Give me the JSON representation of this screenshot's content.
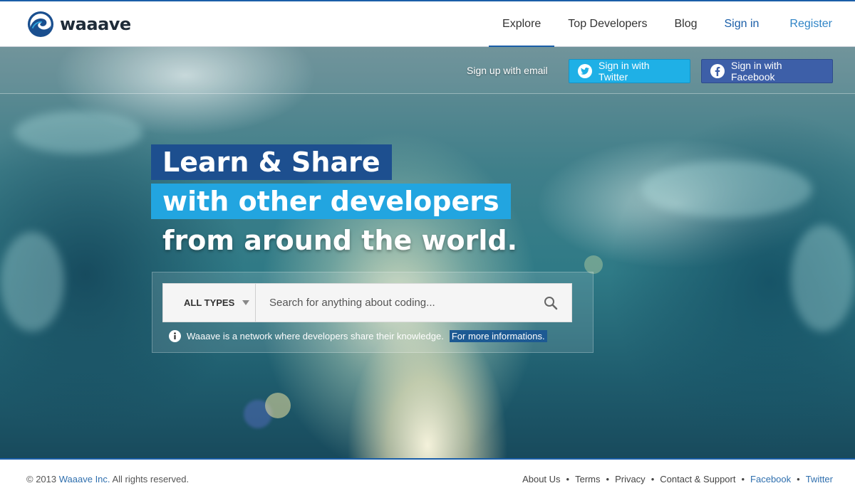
{
  "header": {
    "brand": "waaave",
    "nav": [
      {
        "label": "Explore",
        "active": true
      },
      {
        "label": "Top Developers"
      },
      {
        "label": "Blog"
      },
      {
        "label": "Sign in"
      },
      {
        "label": "Register"
      }
    ]
  },
  "hero": {
    "signup_email": "Sign up with email",
    "twitter_button": "Sign in with Twitter",
    "facebook_button": "Sign in with Facebook",
    "headline": [
      "Learn & Share",
      "with other developers",
      "from around the world."
    ],
    "search": {
      "type_label": "ALL TYPES",
      "placeholder": "Search for anything about coding..."
    },
    "info_text": "Waaave is a network where developers share their knowledge.",
    "info_link": "For more informations."
  },
  "footer": {
    "copyright_prefix": "© 2013",
    "copyright_brand": "Waaave Inc.",
    "copyright_suffix": "All rights reserved.",
    "links": [
      "About Us",
      "Terms",
      "Privacy",
      "Contact & Support"
    ],
    "social_links": [
      "Facebook",
      "Twitter"
    ],
    "separator": "•"
  },
  "colors": {
    "brand_blue": "#1a5ea8",
    "twitter": "#1fb0e6",
    "facebook": "#3d5fa8",
    "headline_dark": "#1d4f8f",
    "headline_light": "#22a5e0"
  },
  "icons": [
    "wave-logo-icon",
    "twitter-bird-icon",
    "facebook-f-icon",
    "dropdown-caret-icon",
    "search-icon",
    "info-icon"
  ]
}
